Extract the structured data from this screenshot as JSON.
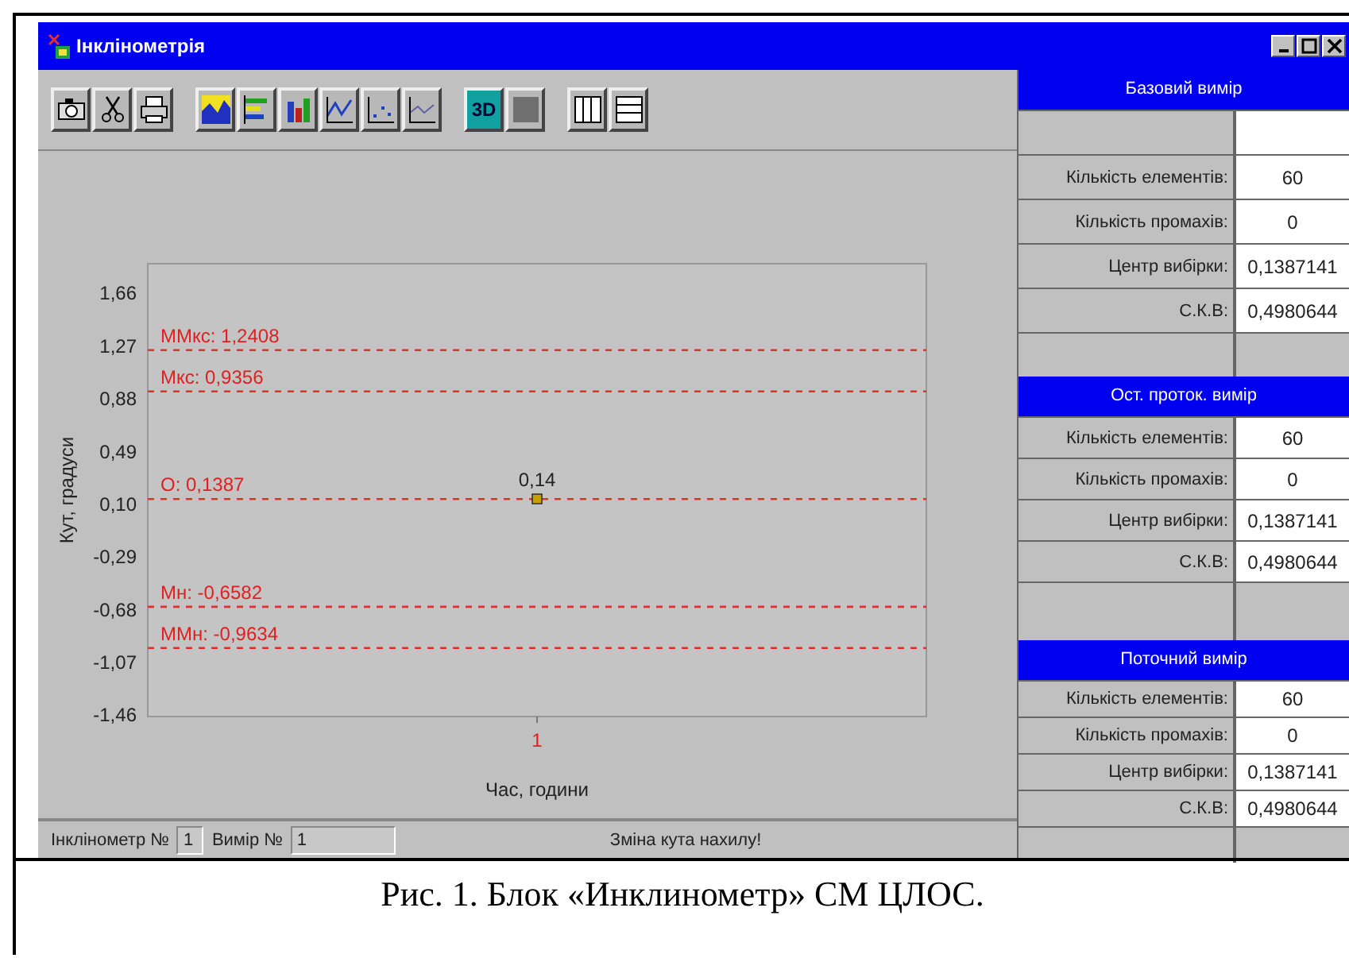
{
  "window": {
    "title": "Інклінометрія"
  },
  "toolbar_groups": [
    {
      "buttons": [
        {
          "kind": "camera"
        },
        {
          "kind": "scissors"
        },
        {
          "kind": "printer"
        }
      ]
    },
    {
      "buttons": [
        {
          "kind": "area"
        },
        {
          "kind": "hbar"
        },
        {
          "kind": "bar"
        },
        {
          "kind": "line"
        },
        {
          "kind": "scatter"
        },
        {
          "kind": "thinline"
        }
      ]
    },
    {
      "buttons": [
        {
          "kind": "text",
          "text": "3D"
        },
        {
          "kind": "blank"
        }
      ]
    },
    {
      "buttons": [
        {
          "kind": "columns"
        },
        {
          "kind": "rows"
        }
      ]
    }
  ],
  "chart_data": {
    "type": "scatter",
    "xlabel": "Час, години",
    "ylabel": "Кут, градуси",
    "categories": [
      "1"
    ],
    "values": [
      0.14
    ],
    "value_labels": [
      "0,14"
    ],
    "ylim": [
      -1.47,
      1.88
    ],
    "yticks": [
      {
        "value": 1.66,
        "label": "1,66"
      },
      {
        "value": 1.27,
        "label": "1,27"
      },
      {
        "value": 0.88,
        "label": "0,88"
      },
      {
        "value": 0.49,
        "label": "0,49"
      },
      {
        "value": 0.1,
        "label": "0,10"
      },
      {
        "value": -0.29,
        "label": "-0,29"
      },
      {
        "value": -0.68,
        "label": "-0,68"
      },
      {
        "value": -1.07,
        "label": "-1,07"
      },
      {
        "value": -1.46,
        "label": "-1,46"
      }
    ],
    "ref_lines": [
      {
        "axis": "y",
        "value": 1.2408,
        "label": "ММкс: 1,2408"
      },
      {
        "axis": "y",
        "value": 0.9356,
        "label": "Мкс: 0,9356"
      },
      {
        "axis": "y",
        "value": 0.1387,
        "label": "О: 0,1387"
      },
      {
        "axis": "y",
        "value": -0.6582,
        "label": "Мн: -0,6582"
      },
      {
        "axis": "y",
        "value": -0.9634,
        "label": "ММн: -0,9634"
      }
    ]
  },
  "status_bar": {
    "inclinometer_label": "Інклінометр №",
    "inclinometer_value": "1",
    "measurement_label": "Вимір №",
    "measurement_value": "1",
    "message": "Зміна кута нахилу!"
  },
  "panels": [
    {
      "title": "Базовий вимір",
      "rows": [
        {
          "kind": "empty"
        },
        {
          "kind": "stat",
          "label": "Кількість елементів:",
          "value": "60"
        },
        {
          "kind": "stat",
          "label": "Кількість промахів:",
          "value": "0"
        },
        {
          "kind": "stat",
          "label": "Центр вибірки:",
          "value": "0,1387141"
        },
        {
          "kind": "stat",
          "label": "С.К.В:",
          "value": "0,4980644"
        },
        {
          "kind": "spacer"
        }
      ]
    },
    {
      "title": "Ост. проток. вимір",
      "rows": [
        {
          "kind": "stat",
          "label": "Кількість елементів:",
          "value": "60"
        },
        {
          "kind": "stat",
          "label": "Кількість промахів:",
          "value": "0"
        },
        {
          "kind": "stat",
          "label": "Центр вибірки:",
          "value": "0,1387141"
        },
        {
          "kind": "stat",
          "label": "С.К.В:",
          "value": "0,4980644"
        },
        {
          "kind": "spacer"
        }
      ]
    },
    {
      "title": "Поточний вимір",
      "rows": [
        {
          "kind": "stat",
          "label": "Кількість елементів:",
          "value": "60"
        },
        {
          "kind": "stat",
          "label": "Кількість промахів:",
          "value": "0"
        },
        {
          "kind": "stat",
          "label": "Центр вибірки:",
          "value": "0,1387141"
        },
        {
          "kind": "stat",
          "label": "С.К.В:",
          "value": "0,4980644"
        },
        {
          "kind": "spacer"
        }
      ]
    }
  ],
  "caption": "Рис. 1. Блок «Инклинометр» СМ ЦЛОС."
}
